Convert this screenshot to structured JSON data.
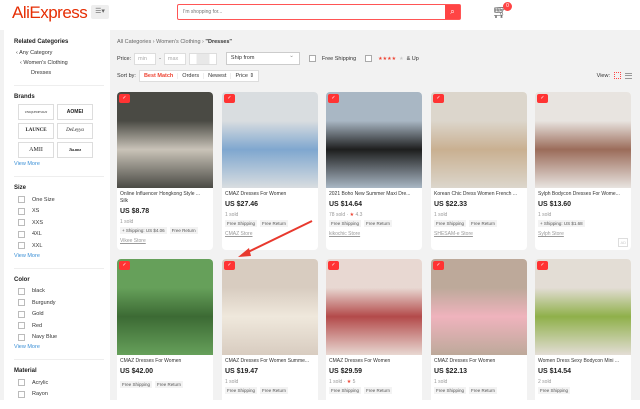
{
  "header": {
    "logo": "AliExpress",
    "menu_icon": "☰▾",
    "search_placeholder": "I'm shopping for...",
    "search_icon": "⌕",
    "cart_count": "0"
  },
  "sidebar": {
    "related_title": "Related Categories",
    "related": [
      "Any Category",
      "Women's Clothing",
      "Dresses"
    ],
    "brands_title": "Brands",
    "brands": [
      "UNIQUEDESIGN",
      "AOMEI",
      "LAUNCE",
      "DeLeyya",
      "AMII",
      "Jia.nnz"
    ],
    "brands_more": "View More",
    "size_title": "Size",
    "sizes": [
      "One Size",
      "XS",
      "XXS",
      "4XL",
      "XXL"
    ],
    "size_more": "View More",
    "color_title": "Color",
    "colors": [
      "black",
      "Burgundy",
      "Gold",
      "Red",
      "Navy Blue"
    ],
    "color_more": "View More",
    "material_title": "Material",
    "materials": [
      "Acrylic",
      "Rayon"
    ]
  },
  "filters": {
    "breadcrumb": [
      "All Categories",
      "Women's Clothing",
      "\"Dresses\""
    ],
    "price_label": "Price:",
    "min": "min",
    "max": "max",
    "dash": "-",
    "ship_from": "Ship from",
    "free_shipping": "Free Shipping",
    "stars": "★★★★",
    "stars_suffix": "& Up"
  },
  "sort": {
    "label": "Sort by:",
    "options": [
      "Best Match",
      "Orders",
      "Newest",
      "Price ⇕"
    ],
    "view_label": "View:"
  },
  "products": [
    {
      "title": "Online Influencer Hongkong Style ...",
      "title2": "Silk",
      "price": "US $8.78",
      "sold": "1 sold",
      "pills": [
        "+ Shipping: US $4.06",
        "Free Return"
      ],
      "store": "Vikee Store",
      "c": "#4a4a44",
      "c2": "#c9c3b8"
    },
    {
      "title": "CMAZ Dresses For Women",
      "price": "US $27.46",
      "sold": "1 sold",
      "pills": [
        "Free Shipping",
        "Free Return"
      ],
      "store": "CMAZ Store",
      "c": "#d9dde0",
      "c2": "#7fa7cf"
    },
    {
      "title": "2021 Boho New Summer Maxi Dre...",
      "price": "US $14.64",
      "sold": "78 sold",
      "rating": "4.3",
      "pills": [
        "Free Shipping",
        "Free Return"
      ],
      "store": "kikochic Store",
      "c": "#a9b7c4",
      "c2": "#1e1e1e"
    },
    {
      "title": "Korean Chic Dress Women French ...",
      "price": "US $22.33",
      "sold": "1 sold",
      "pills": [
        "Free Shipping",
        "Free Return"
      ],
      "store": "SHESAM-e Store",
      "c": "#dcd6cc",
      "c2": "#c9b091"
    },
    {
      "title": "Sylph Bodycon Dresses For Wome...",
      "price": "US $13.60",
      "sold": "1 sold",
      "pills": [
        "+ Shipping: US $1.68"
      ],
      "store": "Sylph Store",
      "ad": "AD",
      "c": "#e8e4e0",
      "c2": "#9b6c5a"
    },
    {
      "title": "CMAZ Dresses For Women",
      "price": "US $42.00",
      "pills": [
        "Free Shipping",
        "Free Return"
      ],
      "c": "#66a05a",
      "c2": "#3c6a34"
    },
    {
      "title": "CMAZ Dresses For Women Summe...",
      "price": "US $19.47",
      "sold": "1 sold",
      "pills": [
        "Free Shipping",
        "Free Return"
      ],
      "c": "#d8ccc0",
      "c2": "#efe8dc"
    },
    {
      "title": "CMAZ Dresses For Women",
      "price": "US $29.59",
      "sold": "1 sold",
      "rating": "5",
      "pills": [
        "Free Shipping",
        "Free Return"
      ],
      "c": "#e8d8d2",
      "c2": "#b34a4a"
    },
    {
      "title": "CMAZ Dresses For Women",
      "price": "US $22.13",
      "sold": "1 sold",
      "pills": [
        "Free Shipping",
        "Free Return"
      ],
      "c": "#bda99a",
      "c2": "#efb3bd"
    },
    {
      "title": "Women Dress Sexy Bodycon Mini ...",
      "price": "US $14.54",
      "sold": "2 sold",
      "pills": [
        "Free Shipping"
      ],
      "c": "#e3ddd5",
      "c2": "#8fb04a"
    }
  ],
  "colors": {
    "accent": "#e62e04",
    "annotation": "#e8392e"
  }
}
